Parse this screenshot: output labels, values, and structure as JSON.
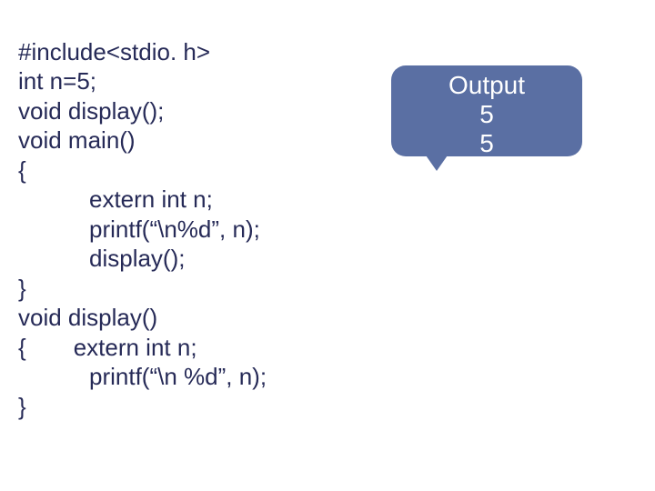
{
  "code": {
    "line1": "#include<stdio. h>",
    "line2": "int n=5;",
    "line3": "void display();",
    "line4": "void main()",
    "line5": "{",
    "line6_kw": "extern int n;",
    "line7": "printf(“\\n%d”, n);",
    "line8": "display();",
    "line9": "}",
    "line10": "void display()",
    "line11a": "{",
    "line11b": "extern int n;",
    "line12": "printf(“\\n %d”, n);",
    "line13": "}"
  },
  "output": {
    "title": "Output",
    "line1": "5",
    "line2": "5"
  }
}
